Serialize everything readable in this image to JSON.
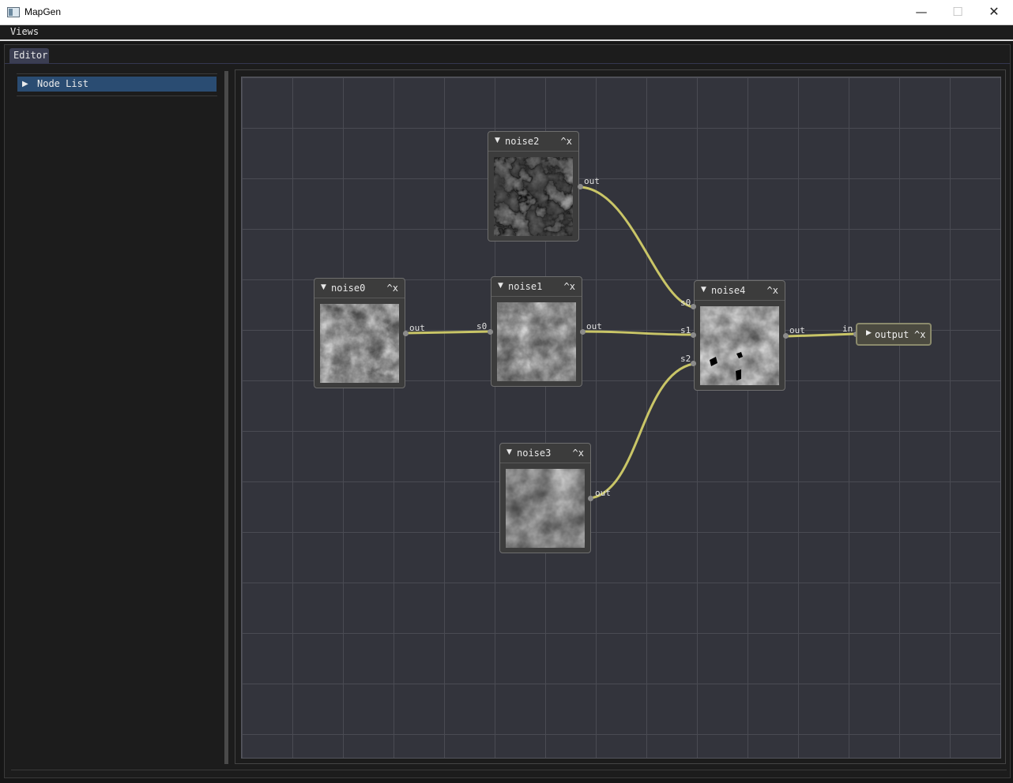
{
  "window": {
    "title": "MapGen",
    "minimize": "—",
    "maximize": "☐",
    "close": "✕"
  },
  "menu": {
    "views": "Views"
  },
  "editor": {
    "tab_label": "Editor"
  },
  "node_list": {
    "arrow": "▶",
    "label": "Node List"
  },
  "nodes": {
    "noise0": {
      "title": "noise0",
      "toggle": "▼",
      "controls": "^x",
      "out": "out"
    },
    "noise1": {
      "title": "noise1",
      "toggle": "▼",
      "controls": "^x",
      "in": "s0",
      "out": "out"
    },
    "noise2": {
      "title": "noise2",
      "toggle": "▼",
      "controls": "^x",
      "out": "out"
    },
    "noise3": {
      "title": "noise3",
      "toggle": "▼",
      "controls": "^x",
      "out": "out"
    },
    "noise4": {
      "title": "noise4",
      "toggle": "▼",
      "controls": "^x",
      "in0": "s0",
      "in1": "s1",
      "in2": "s2",
      "out": "out"
    },
    "output": {
      "title": "output",
      "toggle": "▶",
      "controls": "^x",
      "in": "in"
    }
  },
  "links": [
    {
      "from": "noise0.out",
      "to": "noise1.s0"
    },
    {
      "from": "noise2.out",
      "to": "noise4.s0"
    },
    {
      "from": "noise1.out",
      "to": "noise4.s1"
    },
    {
      "from": "noise3.out",
      "to": "noise4.s2"
    },
    {
      "from": "noise4.out",
      "to": "output.in"
    }
  ],
  "colors": {
    "link": "#c9c567",
    "canvas": "#33343c",
    "grid": "#4a4b53",
    "node_bg": "#3c3c3c",
    "selected_item": "#2a4c72",
    "tab": "#3b3e52"
  }
}
